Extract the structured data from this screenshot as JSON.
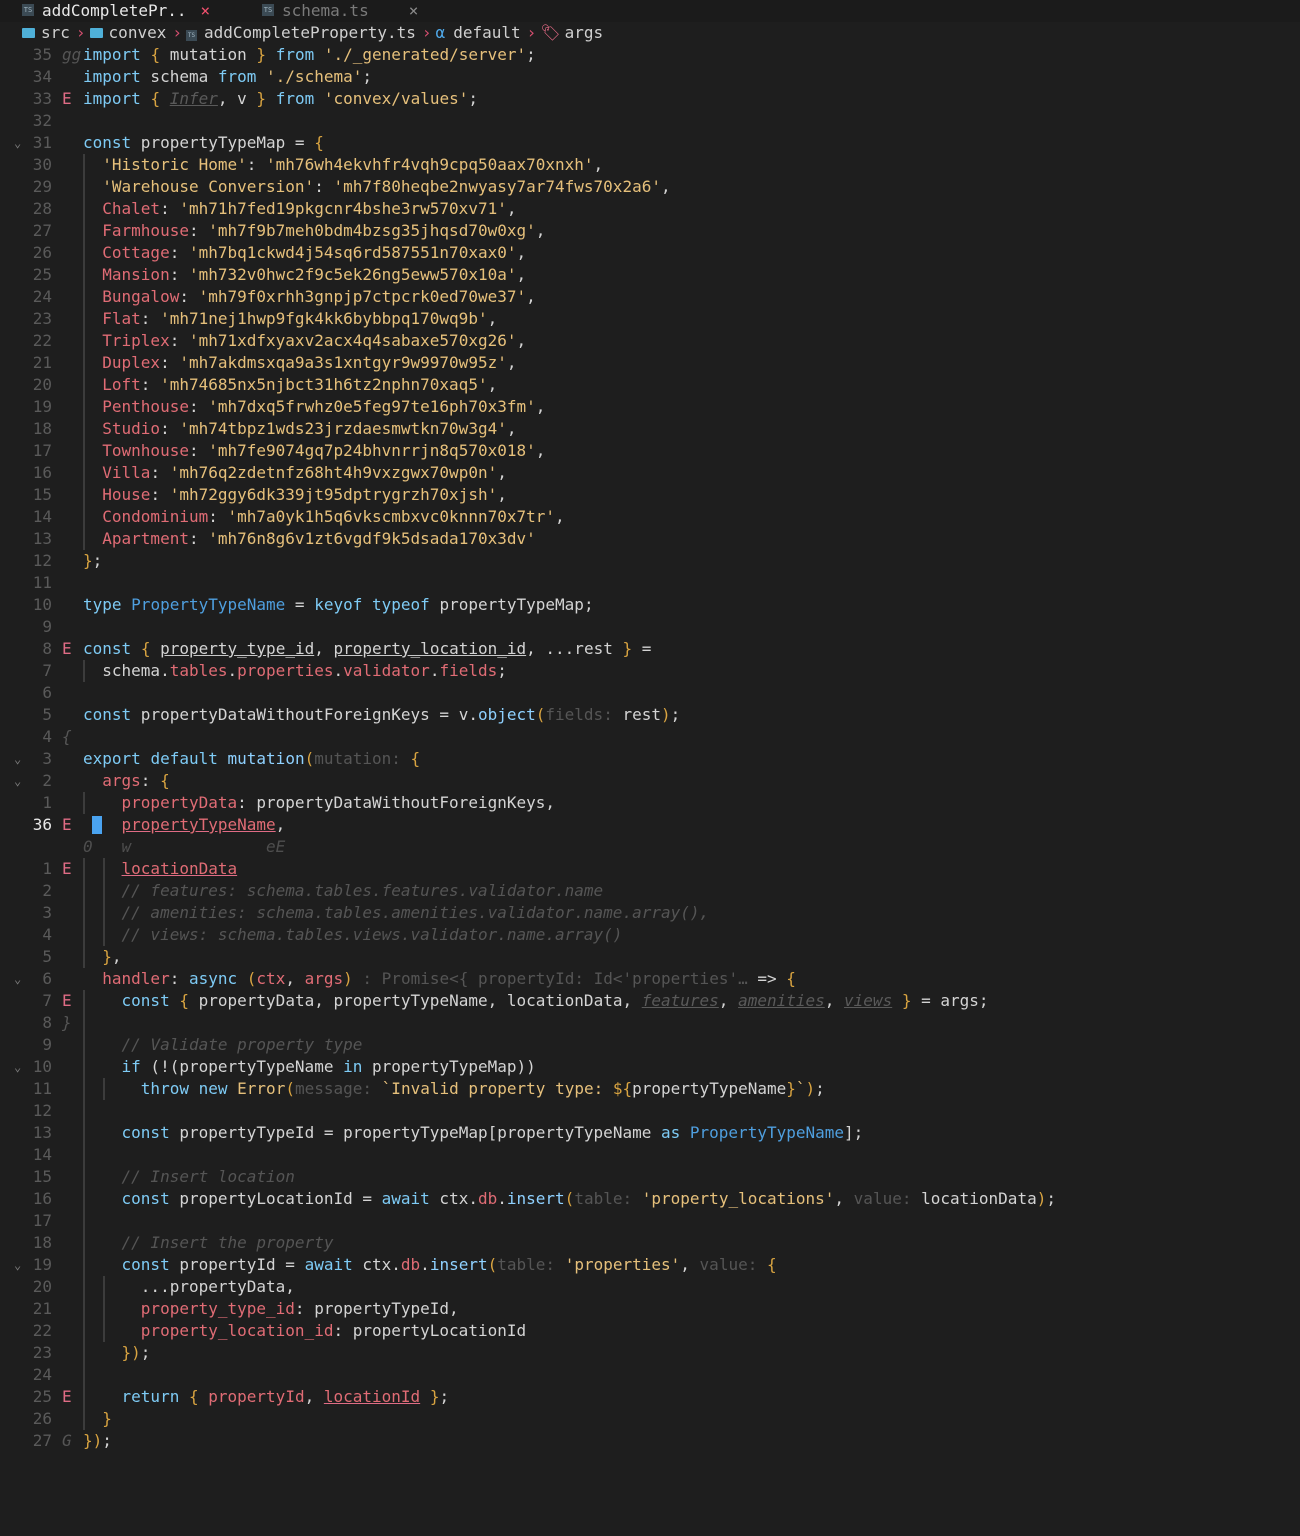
{
  "tabs": [
    {
      "label": "addCompletePr..",
      "close": "×",
      "active": true
    },
    {
      "label": "schema.ts",
      "close": "×",
      "active": false
    }
  ],
  "breadcrumb": {
    "parts": [
      "src",
      "convex",
      "addCompleteProperty.ts",
      "default",
      "args"
    ],
    "symbol_glyph": "α",
    "separator": "›"
  },
  "editor": {
    "lines": [
      {
        "ln": "35",
        "gm": "gg",
        "gmHint": true,
        "html": "<span class=\"kw\">import</span> <span class=\"pun\">{</span> mutation <span class=\"pun\">}</span> <span class=\"kw\">from</span> <span class=\"str\">'./_generated/server'</span>;"
      },
      {
        "ln": "34",
        "html": "<span class=\"kw\">import</span> schema <span class=\"kw\">from</span> <span class=\"str\">'./schema'</span>;"
      },
      {
        "ln": "33",
        "gm": "E",
        "html": "<span class=\"kw\">import</span> <span class=\"pun\">{</span> <span class=\"dim-ital\">Infer</span>, v <span class=\"pun\">}</span> <span class=\"kw\">from</span> <span class=\"str\">'convex/values'</span>;"
      },
      {
        "ln": "32",
        "html": ""
      },
      {
        "ln": "31",
        "fold": true,
        "html": "<span class=\"kw\">const</span> propertyTypeMap = <span class=\"pun\">{</span>"
      },
      {
        "ln": "30",
        "g1": true,
        "html": "  <span class=\"str\">'Historic Home'</span>: <span class=\"str\">'mh76wh4ekvhfr4vqh9cpq50aax70xnxh'</span>,"
      },
      {
        "ln": "29",
        "g1": true,
        "html": "  <span class=\"str\">'Warehouse Conversion'</span>: <span class=\"str\">'mh7f80heqbe2nwyasy7ar74fws70x2a6'</span>,"
      },
      {
        "ln": "28",
        "g1": true,
        "html": "  <span class=\"prop\">Chalet</span>: <span class=\"str\">'mh71h7fed19pkgcnr4bshe3rw570xv71'</span>,"
      },
      {
        "ln": "27",
        "g1": true,
        "html": "  <span class=\"prop\">Farmhouse</span>: <span class=\"str\">'mh7f9b7meh0bdm4bzsg35jhqsd70w0xg'</span>,"
      },
      {
        "ln": "26",
        "g1": true,
        "html": "  <span class=\"prop\">Cottage</span>: <span class=\"str\">'mh7bq1ckwd4j54sq6rd587551n70xax0'</span>,"
      },
      {
        "ln": "25",
        "g1": true,
        "html": "  <span class=\"prop\">Mansion</span>: <span class=\"str\">'mh732v0hwc2f9c5ek26ng5eww570x10a'</span>,"
      },
      {
        "ln": "24",
        "g1": true,
        "html": "  <span class=\"prop\">Bungalow</span>: <span class=\"str\">'mh79f0xrhh3gnpjp7ctpcrk0ed70we37'</span>,"
      },
      {
        "ln": "23",
        "g1": true,
        "html": "  <span class=\"prop\">Flat</span>: <span class=\"str\">'mh71nej1hwp9fgk4kk6bybbpq170wq9b'</span>,"
      },
      {
        "ln": "22",
        "g1": true,
        "html": "  <span class=\"prop\">Triplex</span>: <span class=\"str\">'mh71xdfxyaxv2acx4q4sabaxe570xg26'</span>,"
      },
      {
        "ln": "21",
        "g1": true,
        "html": "  <span class=\"prop\">Duplex</span>: <span class=\"str\">'mh7akdmsxqa9a3s1xntgyr9w9970w95z'</span>,"
      },
      {
        "ln": "20",
        "g1": true,
        "html": "  <span class=\"prop\">Loft</span>: <span class=\"str\">'mh74685nx5njbct31h6tz2nphn70xaq5'</span>,"
      },
      {
        "ln": "19",
        "g1": true,
        "html": "  <span class=\"prop\">Penthouse</span>: <span class=\"str\">'mh7dxq5frwhz0e5feg97te16ph70x3fm'</span>,"
      },
      {
        "ln": "18",
        "g1": true,
        "html": "  <span class=\"prop\">Studio</span>: <span class=\"str\">'mh74tbpz1wds23jrzdaesmwtkn70w3g4'</span>,"
      },
      {
        "ln": "17",
        "g1": true,
        "html": "  <span class=\"prop\">Townhouse</span>: <span class=\"str\">'mh7fe9074gq7p24bhvnrrjn8q570x018'</span>,"
      },
      {
        "ln": "16",
        "g1": true,
        "html": "  <span class=\"prop\">Villa</span>: <span class=\"str\">'mh76q2zdetnfz68ht4h9vxzgwx70wp0n'</span>,"
      },
      {
        "ln": "15",
        "g1": true,
        "html": "  <span class=\"prop\">House</span>: <span class=\"str\">'mh72ggy6dk339jt95dptrygrzh70xjsh'</span>,"
      },
      {
        "ln": "14",
        "g1": true,
        "html": "  <span class=\"prop\">Condominium</span>: <span class=\"str\">'mh7a0yk1h5q6vkscmbxvc0knnn70x7tr'</span>,"
      },
      {
        "ln": "13",
        "g1": true,
        "html": "  <span class=\"prop\">Apartment</span>: <span class=\"str\">'mh76n8g6v1zt6vgdf9k5dsada170x3dv'</span>"
      },
      {
        "ln": "12",
        "html": "<span class=\"pun\">}</span>;"
      },
      {
        "ln": "11",
        "html": ""
      },
      {
        "ln": "10",
        "html": "<span class=\"kw\">type</span> <span class=\"ty\">PropertyTypeName</span> = <span class=\"kw\">keyof</span> <span class=\"kw\">typeof</span> propertyTypeMap;"
      },
      {
        "ln": "9",
        "html": ""
      },
      {
        "ln": "8",
        "gm": "E",
        "html": "<span class=\"kw\">const</span> <span class=\"pun\">{</span> <span class=\"underline-w\">property_type_id</span>, <span class=\"underline-w\">property_location_id</span>, ...rest <span class=\"pun\">}</span> ="
      },
      {
        "ln": "7",
        "g1": true,
        "html": "  schema.<span class=\"prop\">tables</span>.<span class=\"prop\">properties</span>.<span class=\"prop\">validator</span>.<span class=\"prop\">fields</span>;"
      },
      {
        "ln": "6",
        "html": ""
      },
      {
        "ln": "5",
        "html": "<span class=\"kw\">const</span> propertyDataWithoutForeignKeys = v.<span class=\"fn\">object</span><span class=\"pun\">(</span><span class=\"hint\">fields: </span>rest<span class=\"pun\">)</span>;"
      },
      {
        "ln": "4",
        "gm": "{",
        "gmHint": true,
        "html": ""
      },
      {
        "ln": "3",
        "fold": true,
        "html": "<span class=\"kw\">export</span> <span class=\"kw\">default</span> <span class=\"fn\">mutation</span><span class=\"pun\">(</span><span class=\"hint\">mutation: </span><span class=\"pun\">{</span>"
      },
      {
        "ln": "2",
        "fold": true,
        "g1": false,
        "html": "  <span class=\"prop\">args</span>: <span class=\"pun\">{</span>"
      },
      {
        "ln": "1",
        "g1": true,
        "html": "    <span class=\"prop\">propertyData</span>: propertyDataWithoutForeignKeys,"
      },
      {
        "ln": "36",
        "current": true,
        "gm": "E",
        "cursor": true,
        "html": "    <span class=\"prop underline-err\">propertyTypeName</span>,"
      },
      {
        "ln": "",
        "virt": true,
        "html": "<span class=\"virt\">0   w              eE</span>"
      },
      {
        "ln": "1",
        "gm": "E",
        "g1": true,
        "g2": true,
        "html": "    <span class=\"prop underline-err\">locationData</span>"
      },
      {
        "ln": "2",
        "g1": true,
        "g2": true,
        "html": "    <span class=\"cmt\">// features: schema.tables.features.validator.name</span>"
      },
      {
        "ln": "3",
        "g1": true,
        "g2": true,
        "html": "    <span class=\"cmt\">// amenities: schema.tables.amenities.validator.name.array(),</span>"
      },
      {
        "ln": "4",
        "g1": true,
        "g2": true,
        "html": "    <span class=\"cmt\">// views: schema.tables.views.validator.name.array()</span>"
      },
      {
        "ln": "5",
        "g1": true,
        "html": "  <span class=\"pun\">}</span>,"
      },
      {
        "ln": "6",
        "fold": true,
        "html": "  <span class=\"prop\">handler</span>: <span class=\"kw\">async</span> <span class=\"pun\">(</span><span class=\"prop\">ctx</span>, <span class=\"prop\">args</span><span class=\"pun\">)</span> <span class=\"hint\">: Promise&lt;{ propertyId: Id&lt;'properties'… </span>=&gt; <span class=\"pun\">{</span>"
      },
      {
        "ln": "7",
        "gm": "E",
        "g1": true,
        "html": "    <span class=\"kw\">const</span> <span class=\"pun\">{</span> propertyData, propertyTypeName, locationData, <span class=\"dim-ital\">features</span>, <span class=\"dim-ital\">amenities</span>, <span class=\"dim-ital\">views</span> <span class=\"pun\">}</span> = args;"
      },
      {
        "ln": "8",
        "gm": "}",
        "gmHint": true,
        "g1": true,
        "html": ""
      },
      {
        "ln": "9",
        "g1": true,
        "html": "    <span class=\"cmt\">// Validate property type</span>"
      },
      {
        "ln": "10",
        "fold": true,
        "g1": true,
        "html": "    <span class=\"ctl\">if</span> (!(propertyTypeName <span class=\"kw\">in</span> propertyTypeMap))"
      },
      {
        "ln": "11",
        "g1": true,
        "g2": true,
        "html": "      <span class=\"ctl\">throw</span> <span class=\"kw\">new</span> <span class=\"str\">Error</span><span class=\"pun\">(</span><span class=\"hint\">message: </span><span class=\"str\">`Invalid property type: </span><span class=\"pun\">${</span>propertyTypeName<span class=\"pun\">}</span><span class=\"str\">`</span><span class=\"pun\">)</span>;"
      },
      {
        "ln": "12",
        "g1": true,
        "html": ""
      },
      {
        "ln": "13",
        "g1": true,
        "html": "    <span class=\"kw\">const</span> propertyTypeId = propertyTypeMap[propertyTypeName <span class=\"kw\">as</span> <span class=\"ty\">PropertyTypeName</span>];"
      },
      {
        "ln": "14",
        "g1": true,
        "html": ""
      },
      {
        "ln": "15",
        "g1": true,
        "html": "    <span class=\"cmt\">// Insert location</span>"
      },
      {
        "ln": "16",
        "g1": true,
        "html": "    <span class=\"kw\">const</span> propertyLocationId = <span class=\"kw\">await</span> ctx.<span class=\"prop\">db</span>.<span class=\"fn\">insert</span><span class=\"pun\">(</span><span class=\"hint\">table: </span><span class=\"str\">'property_locations'</span>, <span class=\"hint\">value: </span>locationData<span class=\"pun\">)</span>;"
      },
      {
        "ln": "17",
        "g1": true,
        "html": ""
      },
      {
        "ln": "18",
        "g1": true,
        "html": "    <span class=\"cmt\">// Insert the property</span>"
      },
      {
        "ln": "19",
        "fold": true,
        "g1": true,
        "html": "    <span class=\"kw\">const</span> propertyId = <span class=\"kw\">await</span> ctx.<span class=\"prop\">db</span>.<span class=\"fn\">insert</span><span class=\"pun\">(</span><span class=\"hint\">table: </span><span class=\"str\">'properties'</span>, <span class=\"hint\">value: </span><span class=\"pun\">{</span>"
      },
      {
        "ln": "20",
        "g1": true,
        "g2": true,
        "html": "      ...propertyData,"
      },
      {
        "ln": "21",
        "g1": true,
        "g2": true,
        "html": "      <span class=\"prop\">property_type_id</span>: propertyTypeId,"
      },
      {
        "ln": "22",
        "g1": true,
        "g2": true,
        "html": "      <span class=\"prop\">property_location_id</span>: propertyLocationId"
      },
      {
        "ln": "23",
        "g1": true,
        "html": "    <span class=\"pun\">})</span>;"
      },
      {
        "ln": "24",
        "g1": true,
        "html": ""
      },
      {
        "ln": "25",
        "gm": "E",
        "g1": true,
        "html": "    <span class=\"kw\">return</span> <span class=\"pun\">{</span> <span class=\"prop\">propertyId</span>, <span class=\"prop underline-err\">locationId</span> <span class=\"pun\">}</span>;"
      },
      {
        "ln": "26",
        "g1": true,
        "html": "  <span class=\"pun\">}</span>"
      },
      {
        "ln": "27",
        "gm": "G",
        "gmHint": true,
        "html": "<span class=\"pun\">})</span>;"
      }
    ]
  }
}
